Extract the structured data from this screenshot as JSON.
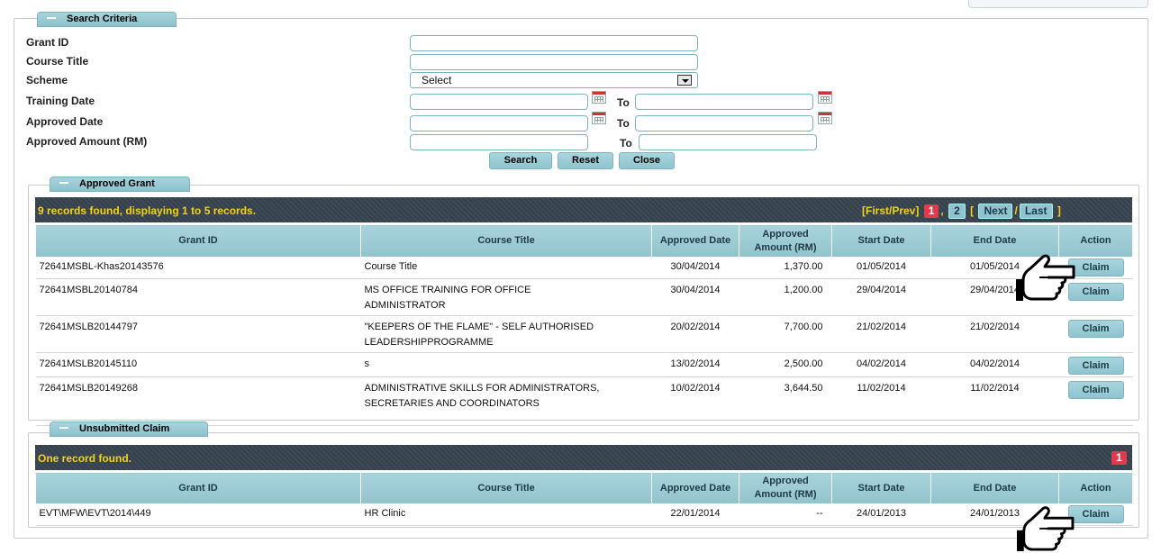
{
  "search": {
    "legend": "Search Criteria",
    "fields": {
      "grant_id": {
        "label": "Grant ID",
        "value": ""
      },
      "course_title": {
        "label": "Course Title",
        "value": ""
      },
      "scheme": {
        "label": "Scheme",
        "selected": "Select"
      },
      "training_date": {
        "label": "Training Date",
        "to": "To"
      },
      "approved_date": {
        "label": "Approved Date",
        "to": "To"
      },
      "approved_amount": {
        "label": "Approved Amount (RM)",
        "to": "To"
      }
    },
    "buttons": {
      "search": "Search",
      "reset": "Reset",
      "close": "Close"
    }
  },
  "approved": {
    "legend": "Approved Grant",
    "summary": "9 records found, displaying 1 to 5 records.",
    "pager": {
      "first_prev": "[First/Prev]",
      "page1": "1",
      "sep": ",",
      "page2": "2",
      "open": "[",
      "next": "Next",
      "slash": "/",
      "last": "Last",
      "close": "]"
    },
    "columns": {
      "grant_id": "Grant ID",
      "course_title": "Course Title",
      "approved_date": "Approved Date",
      "approved_amount": "Approved Amount (RM)",
      "start_date": "Start Date",
      "end_date": "End Date",
      "action": "Action"
    },
    "rows": [
      {
        "grant_id": "72641MSBL-Khas20143576",
        "course_title": "Course Title",
        "approved_date": "30/04/2014",
        "amount": "1,370.00",
        "start_date": "01/05/2014",
        "end_date": "01/05/2014",
        "action": "Claim"
      },
      {
        "grant_id": "72641MSBL20140784",
        "course_title": "MS OFFICE TRAINING FOR OFFICE ADMINISTRATOR",
        "approved_date": "30/04/2014",
        "amount": "1,200.00",
        "start_date": "29/04/2014",
        "end_date": "29/04/2014",
        "action": "Claim"
      },
      {
        "grant_id": "72641MSLB20144797",
        "course_title": "\"KEEPERS OF THE FLAME\" - SELF AUTHORISED LEADERSHIPPROGRAMME",
        "approved_date": "20/02/2014",
        "amount": "7,700.00",
        "start_date": "21/02/2014",
        "end_date": "21/02/2014",
        "action": "Claim"
      },
      {
        "grant_id": "72641MSLB20145110",
        "course_title": "s",
        "approved_date": "13/02/2014",
        "amount": "2,500.00",
        "start_date": "04/02/2014",
        "end_date": "04/02/2014",
        "action": "Claim"
      },
      {
        "grant_id": "72641MSLB20149268",
        "course_title": "ADMINISTRATIVE SKILLS FOR ADMINISTRATORS, SECRETARIES AND COORDINATORS",
        "approved_date": "10/02/2014",
        "amount": "3,644.50",
        "start_date": "11/02/2014",
        "end_date": "11/02/2014",
        "action": "Claim"
      }
    ]
  },
  "unsubmitted": {
    "legend": "Unsubmitted Claim",
    "summary": "One record found.",
    "pager": {
      "page1": "1"
    },
    "columns": {
      "grant_id": "Grant ID",
      "course_title": "Course Title",
      "approved_date": "Approved Date",
      "approved_amount": "Approved Amount (RM)",
      "start_date": "Start Date",
      "end_date": "End Date",
      "action": "Action"
    },
    "rows": [
      {
        "grant_id": "EVT\\MFW\\EVT\\2014\\449",
        "course_title": "HR Clinic",
        "approved_date": "22/01/2014",
        "amount": "--",
        "start_date": "24/01/2013",
        "end_date": "24/01/2013",
        "action": "Claim"
      }
    ]
  },
  "icons": {
    "pointer": "hand-pointer-icon",
    "calendar": "calendar-icon",
    "dropdown": "chevron-down-icon"
  },
  "colors": {
    "header_bg": "#91c3cd",
    "bar_bg": "#3a4651",
    "bar_text": "#f2d21a",
    "page_active": "#e23a4c"
  }
}
